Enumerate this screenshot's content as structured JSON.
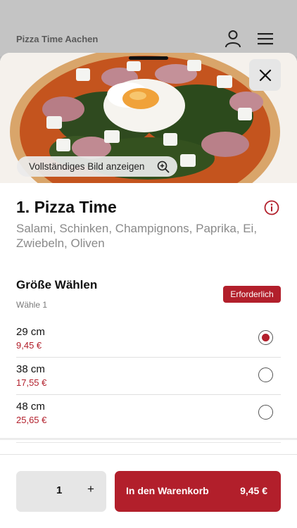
{
  "background": {
    "restaurant_name": "Pizza Time Aachen",
    "user_icon": "user-icon",
    "menu_icon": "hamburger-menu-icon"
  },
  "product": {
    "image_action_label": "Vollständiges Bild anzeigen",
    "title": "1. Pizza Time",
    "description": "Salami, Schinken, Champignons, Paprika, Ei, Zwiebeln, Oliven"
  },
  "size_section": {
    "title": "Größe Wählen",
    "subtitle": "Wähle 1",
    "badge": "Erforderlich",
    "options": [
      {
        "size": "29 cm",
        "price": "9,45 €",
        "selected": true
      },
      {
        "size": "38 cm",
        "price": "17,55 €",
        "selected": false
      },
      {
        "size": "48 cm",
        "price": "25,65 €",
        "selected": false
      }
    ]
  },
  "footer": {
    "quantity": "1",
    "plus": "+",
    "cart_label": "In den Warenkorb",
    "cart_total": "9,45 €"
  },
  "colors": {
    "accent": "#b21f2b",
    "muted_text": "#8a8a8a",
    "control_bg": "#e6e6e6"
  }
}
